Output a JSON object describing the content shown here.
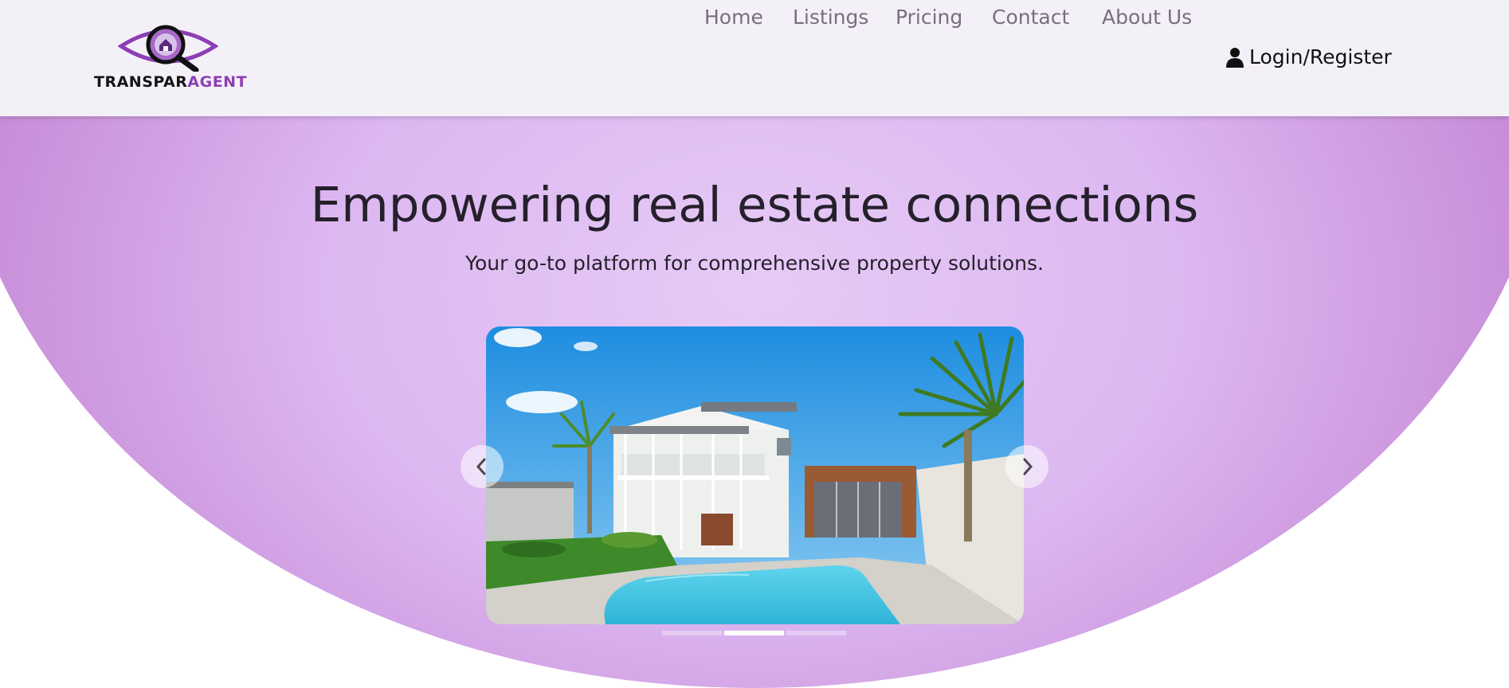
{
  "brand": {
    "name_part1": "TRANSPAR",
    "name_part2": "AGENT",
    "accent_color": "#8c3fb4",
    "mark_icon": "eye-house-magnifier-icon"
  },
  "nav": {
    "links": [
      {
        "label": "Home"
      },
      {
        "label": "Listings"
      },
      {
        "label": "Pricing"
      },
      {
        "label": "Contact"
      },
      {
        "label": "About Us"
      }
    ],
    "login": {
      "label": "Login/Register",
      "icon": "user-icon"
    }
  },
  "hero": {
    "title": "Empowering real estate connections",
    "subtitle": "Your go-to platform for comprehensive property solutions.",
    "background_colors": [
      "#e6cbf6",
      "#b874cc"
    ]
  },
  "carousel": {
    "image": "house-with-pool-photo",
    "prev_icon": "chevron-left-icon",
    "next_icon": "chevron-right-icon",
    "slide_count": 3,
    "active_slide": 2
  }
}
